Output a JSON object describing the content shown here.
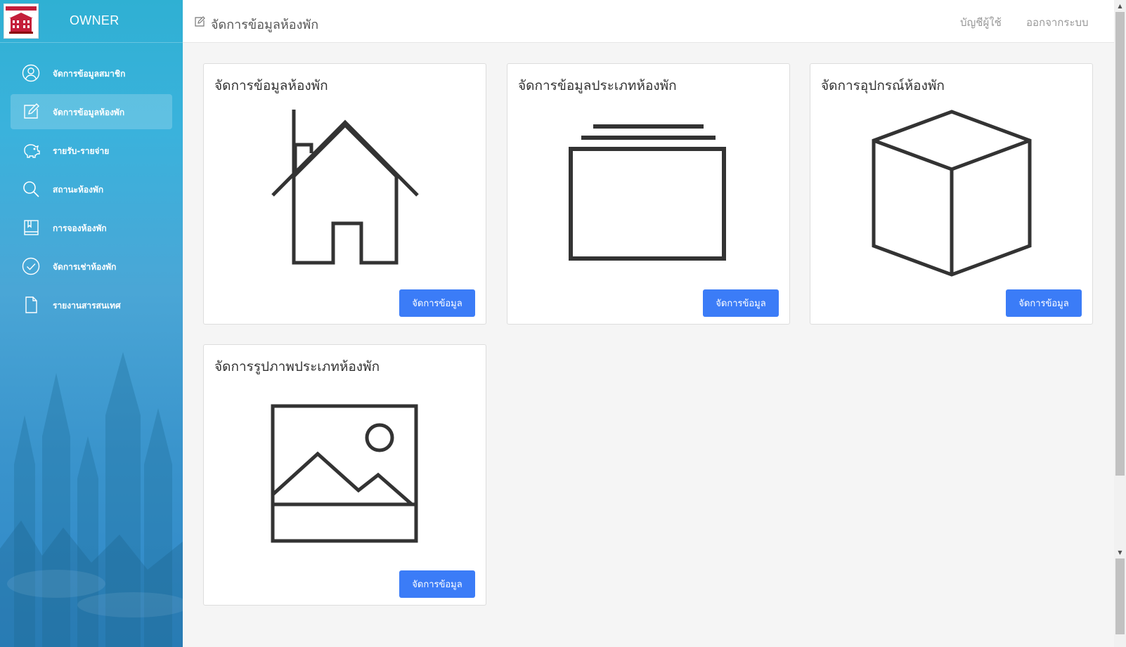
{
  "sidebar": {
    "brand": "OWNER",
    "logo_icon": "hotel-logo",
    "items": [
      {
        "label": "จัดการข้อมูลสมาชิก",
        "icon": "user-circle-icon"
      },
      {
        "label": "จัดการข้อมูลห้องพัก",
        "icon": "edit-icon",
        "active": true
      },
      {
        "label": "รายรับ-รายจ่าย",
        "icon": "piggy-bank-icon"
      },
      {
        "label": "สถานะห้องพัก",
        "icon": "search-icon"
      },
      {
        "label": "การจองห้องพัก",
        "icon": "bookmark-book-icon"
      },
      {
        "label": "จัดการเช่าห้องพัก",
        "icon": "check-circle-icon"
      },
      {
        "label": "รายงานสารสนเทศ",
        "icon": "file-icon"
      }
    ]
  },
  "header": {
    "title": "จัดการข้อมูลห้องพัก",
    "account_label": "บัญชีผู้ใช้",
    "logout_label": "ออกจากระบบ"
  },
  "cards": [
    {
      "title": "จัดการข้อมูลห้องพัก",
      "icon": "house-icon",
      "button": "จัดการข้อมูล"
    },
    {
      "title": "จัดการข้อมูลประเภทห้องพัก",
      "icon": "layers-icon",
      "button": "จัดการข้อมูล"
    },
    {
      "title": "จัดการอุปกรณ์ห้องพัก",
      "icon": "box-icon",
      "button": "จัดการข้อมูล"
    },
    {
      "title": "จัดการรูปภาพประเภทห้องพัก",
      "icon": "image-icon",
      "button": "จัดการข้อมูล"
    }
  ],
  "colors": {
    "sidebar_top": "#2fb0d3",
    "sidebar_bottom": "#2f87c7",
    "button": "#3b7cf7",
    "background": "#f5f5f5"
  }
}
